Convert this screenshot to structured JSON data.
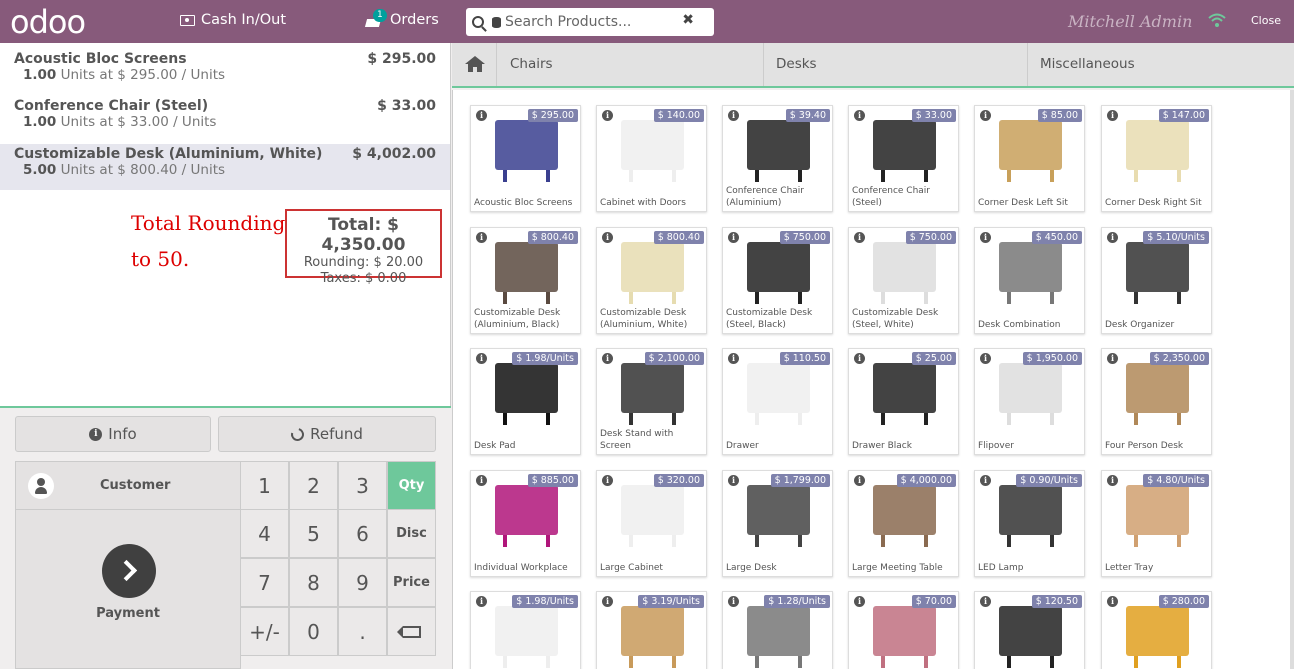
{
  "header": {
    "logo": "odoo",
    "cash_label": "Cash In/Out",
    "orders_label": "Orders",
    "orders_badge": "1",
    "search_placeholder": "Search Products...",
    "user": "Mitchell Admin",
    "close_label": "Close",
    "brand_color": "#875a7b"
  },
  "order": {
    "lines": [
      {
        "name": "Acoustic Bloc Screens",
        "price": "$ 295.00",
        "qty": "1.00",
        "info": "Units at $ 295.00 / Units",
        "selected": false
      },
      {
        "name": "Conference Chair (Steel)",
        "price": "$ 33.00",
        "qty": "1.00",
        "info": "Units at $ 33.00 / Units",
        "selected": false
      },
      {
        "name": "Customizable Desk (Aluminium, White)",
        "price": "$ 4,002.00",
        "qty": "5.00",
        "info": "Units at $ 800.40 / Units",
        "selected": true
      }
    ],
    "annotation_line1": "Total Rounding",
    "annotation_line2": "to 50.",
    "total": "Total: $ 4,350.00",
    "rounding": "Rounding: $ 20.00",
    "taxes": "Taxes: $ 0.00"
  },
  "controls": {
    "info_label": "Info",
    "refund_label": "Refund",
    "customer_label": "Customer",
    "payment_label": "Payment"
  },
  "numpad": {
    "keys": [
      "1",
      "2",
      "3",
      "4",
      "5",
      "6",
      "7",
      "8",
      "9",
      "+/-",
      "0",
      "."
    ],
    "modes": [
      "Qty",
      "Disc",
      "Price"
    ],
    "active_mode": "Qty"
  },
  "categories": [
    "Chairs",
    "Desks",
    "Miscellaneous"
  ],
  "products": [
    {
      "name": "Acoustic Bloc Screens",
      "price": "$ 295.00"
    },
    {
      "name": "Cabinet with Doors",
      "price": "$ 140.00"
    },
    {
      "name": "Conference Chair (Aluminium)",
      "price": "$ 39.40"
    },
    {
      "name": "Conference Chair (Steel)",
      "price": "$ 33.00"
    },
    {
      "name": "Corner Desk Left Sit",
      "price": "$ 85.00"
    },
    {
      "name": "Corner Desk Right Sit",
      "price": "$ 147.00"
    },
    {
      "name": "Customizable Desk (Aluminium, Black)",
      "price": "$ 800.40"
    },
    {
      "name": "Customizable Desk (Aluminium, White)",
      "price": "$ 800.40"
    },
    {
      "name": "Customizable Desk (Steel, Black)",
      "price": "$ 750.00"
    },
    {
      "name": "Customizable Desk (Steel, White)",
      "price": "$ 750.00"
    },
    {
      "name": "Desk Combination",
      "price": "$ 450.00"
    },
    {
      "name": "Desk Organizer",
      "price": "$ 5.10/Units"
    },
    {
      "name": "Desk Pad",
      "price": "$ 1.98/Units"
    },
    {
      "name": "Desk Stand with Screen",
      "price": "$ 2,100.00"
    },
    {
      "name": "Drawer",
      "price": "$ 110.50"
    },
    {
      "name": "Drawer Black",
      "price": "$ 25.00"
    },
    {
      "name": "Flipover",
      "price": "$ 1,950.00"
    },
    {
      "name": "Four Person Desk",
      "price": "$ 2,350.00"
    },
    {
      "name": "Individual Workplace",
      "price": "$ 885.00"
    },
    {
      "name": "Large Cabinet",
      "price": "$ 320.00"
    },
    {
      "name": "Large Desk",
      "price": "$ 1,799.00"
    },
    {
      "name": "Large Meeting Table",
      "price": "$ 4,000.00"
    },
    {
      "name": "LED Lamp",
      "price": "$ 0.90/Units"
    },
    {
      "name": "Letter Tray",
      "price": "$ 4.80/Units"
    },
    {
      "name": "",
      "price": "$ 1.98/Units"
    },
    {
      "name": "",
      "price": "$ 3.19/Units"
    },
    {
      "name": "",
      "price": "$ 1.28/Units"
    },
    {
      "name": "",
      "price": "$ 70.00"
    },
    {
      "name": "",
      "price": "$ 120.50"
    },
    {
      "name": "",
      "price": "$ 280.00"
    }
  ],
  "icons": {
    "cash": "cash-icon",
    "orders": "orders-icon",
    "search": "search-icon",
    "wifi": "wifi-icon",
    "home": "home-icon",
    "info": "info-icon",
    "refund": "refund-icon",
    "backspace": "backspace-icon"
  },
  "colors": {
    "accent_green": "#6ec89b",
    "price_badge": "#7f82ac",
    "annotation_red": "#dd0000"
  }
}
